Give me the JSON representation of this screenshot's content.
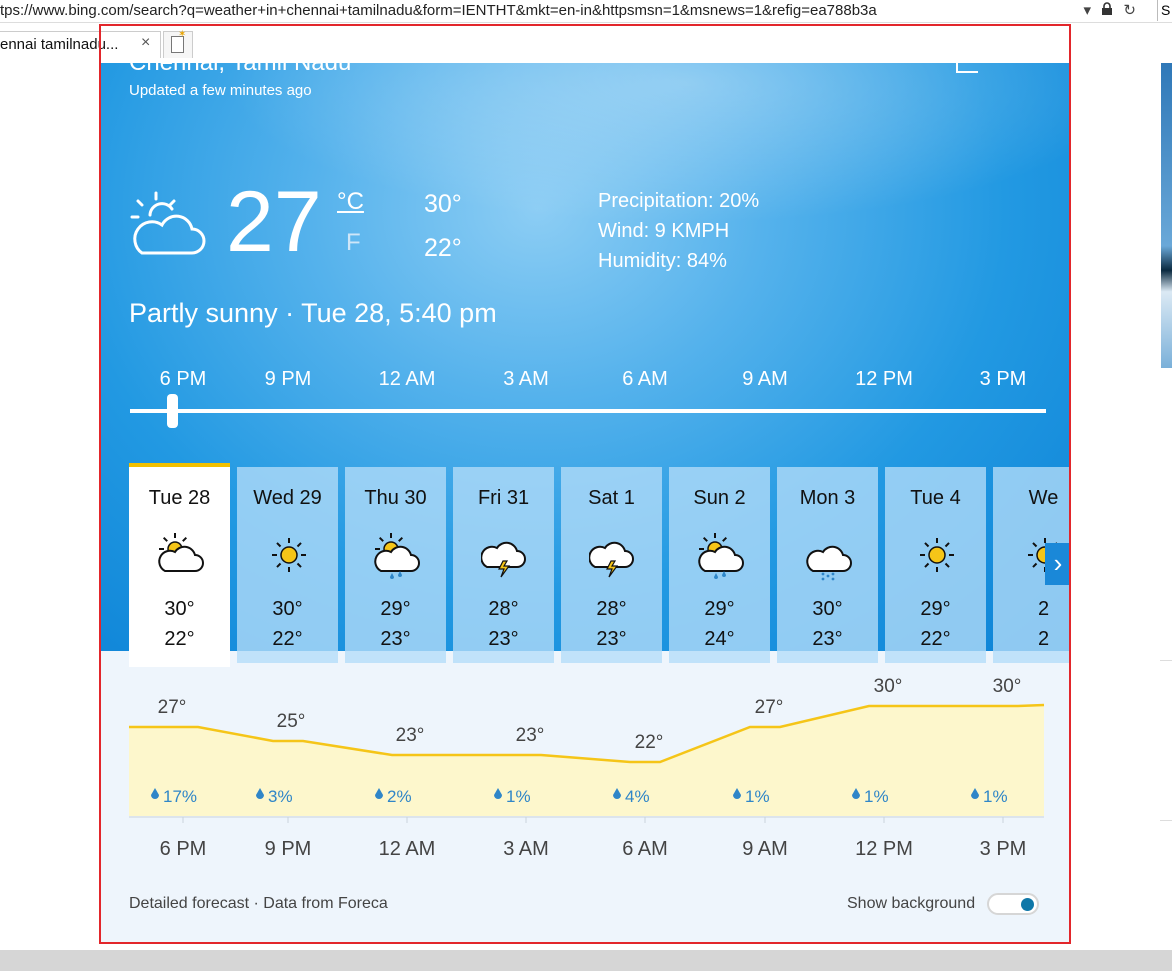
{
  "browser": {
    "url": "tps://www.bing.com/search?q=weather+in+chennai+tamilnadu&form=IENTHT&mkt=en-in&httpsmsn=1&msnews=1&refig=ea788b3a",
    "tab_title": "ennai tamilnadu...",
    "tab_close": "×",
    "dropdown_glyph": "▾",
    "lock_glyph": "🔒",
    "refresh_glyph": "↻",
    "side_letter": "S"
  },
  "weather": {
    "city": "Chennai, Tamil Nadu",
    "updated": "Updated a few minutes ago",
    "more": "···",
    "temp": "27",
    "unit_c": "°C",
    "unit_f": "F",
    "high": "30°",
    "low": "22°",
    "precipitation": "Precipitation: 20%",
    "wind": "Wind: 9 KMPH",
    "humidity": "Humidity: 84%",
    "condition": "Partly sunny · Tue 28, 5:40 pm",
    "slider_fraction": 0.04,
    "hours": [
      "6 PM",
      "9 PM",
      "12 AM",
      "3 AM",
      "6 AM",
      "9 AM",
      "12 PM",
      "3 PM"
    ],
    "days": [
      {
        "name": "Tue 28",
        "icon": "partly-sunny-icon",
        "high": "30°",
        "low": "22°"
      },
      {
        "name": "Wed 29",
        "icon": "sunny-icon",
        "high": "30°",
        "low": "22°"
      },
      {
        "name": "Thu 30",
        "icon": "sun-rain-icon",
        "high": "29°",
        "low": "23°"
      },
      {
        "name": "Fri 31",
        "icon": "thunderstorm-icon",
        "high": "28°",
        "low": "23°"
      },
      {
        "name": "Sat 1",
        "icon": "thunderstorm-icon",
        "high": "28°",
        "low": "23°"
      },
      {
        "name": "Sun 2",
        "icon": "sun-rain-icon",
        "high": "29°",
        "low": "24°"
      },
      {
        "name": "Mon 3",
        "icon": "rain-icon",
        "high": "30°",
        "low": "23°"
      },
      {
        "name": "Tue 4",
        "icon": "sunny-icon",
        "high": "29°",
        "low": "22°"
      },
      {
        "name": "We",
        "icon": "sunny-icon",
        "high": "2",
        "low": "2"
      }
    ],
    "next_arrow": "›",
    "graph": {
      "temps": [
        27,
        25,
        23,
        23,
        22,
        27,
        30,
        30
      ],
      "temp_labels": [
        "27°",
        "25°",
        "23°",
        "23°",
        "22°",
        "27°",
        "30°",
        "30°"
      ],
      "precip": [
        "17%",
        "3%",
        "2%",
        "1%",
        "4%",
        "1%",
        "1%",
        "1%"
      ],
      "line_color": "#f5c518",
      "fill_color": "#fdf7cc",
      "drop_color": "#2f86c8"
    },
    "footer": "Detailed forecast · Data from Foreca",
    "show_background": "Show background",
    "show_background_on": true
  }
}
